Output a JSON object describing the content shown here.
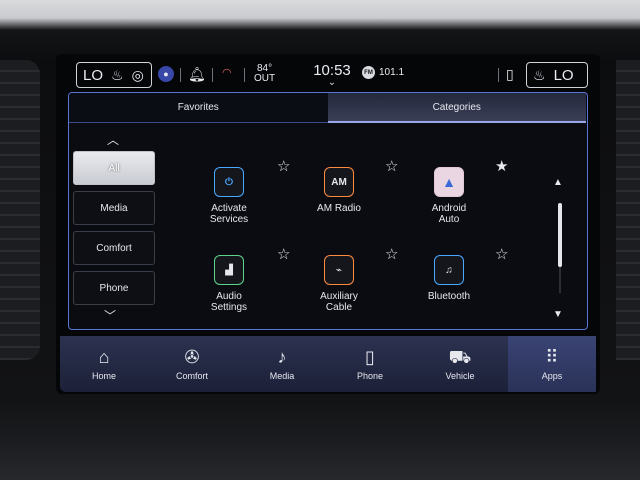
{
  "status_bar": {
    "left_temp": "LO",
    "right_temp": "LO",
    "outside_temp": "84°",
    "outside_label": "OUT",
    "time": "10:53",
    "radio_badge": "FM",
    "radio_station": "101.1"
  },
  "tabs": [
    {
      "label": "Favorites",
      "active": false
    },
    {
      "label": "Categories",
      "active": true
    }
  ],
  "categories": [
    {
      "label": "All",
      "active": true
    },
    {
      "label": "Media",
      "active": false
    },
    {
      "label": "Comfort",
      "active": false
    },
    {
      "label": "Phone",
      "active": false
    }
  ],
  "apps": [
    {
      "label_1": "Activate",
      "label_2": "Services",
      "icon": "activate-services-icon",
      "color": "#4aa8ff",
      "favorite": false
    },
    {
      "label_1": "AM Radio",
      "label_2": "",
      "icon": "am-radio-icon",
      "icon_text": "AM",
      "color": "#ff8a3d",
      "favorite": false
    },
    {
      "label_1": "Android",
      "label_2": "Auto",
      "icon": "android-auto-icon",
      "color": "#e3c9d8",
      "favorite": true
    },
    {
      "label_1": "Audio",
      "label_2": "Settings",
      "icon": "audio-settings-icon",
      "color": "#5fd38a",
      "favorite": false
    },
    {
      "label_1": "Auxiliary",
      "label_2": "Cable",
      "icon": "auxiliary-cable-icon",
      "color": "#ff8a3d",
      "favorite": false
    },
    {
      "label_1": "Bluetooth",
      "label_2": "",
      "icon": "bluetooth-icon",
      "color": "#4aa8ff",
      "favorite": false
    }
  ],
  "nav": [
    {
      "label": "Home",
      "icon": "home-icon",
      "active": false
    },
    {
      "label": "Comfort",
      "icon": "comfort-icon",
      "active": false
    },
    {
      "label": "Media",
      "icon": "media-icon",
      "active": false
    },
    {
      "label": "Phone",
      "icon": "phone-icon",
      "active": false
    },
    {
      "label": "Vehicle",
      "icon": "vehicle-icon",
      "active": false
    },
    {
      "label": "Apps",
      "icon": "apps-icon",
      "active": true
    }
  ],
  "colors": {
    "accent": "#5a74d8",
    "nav_bg": "#2c3250"
  }
}
